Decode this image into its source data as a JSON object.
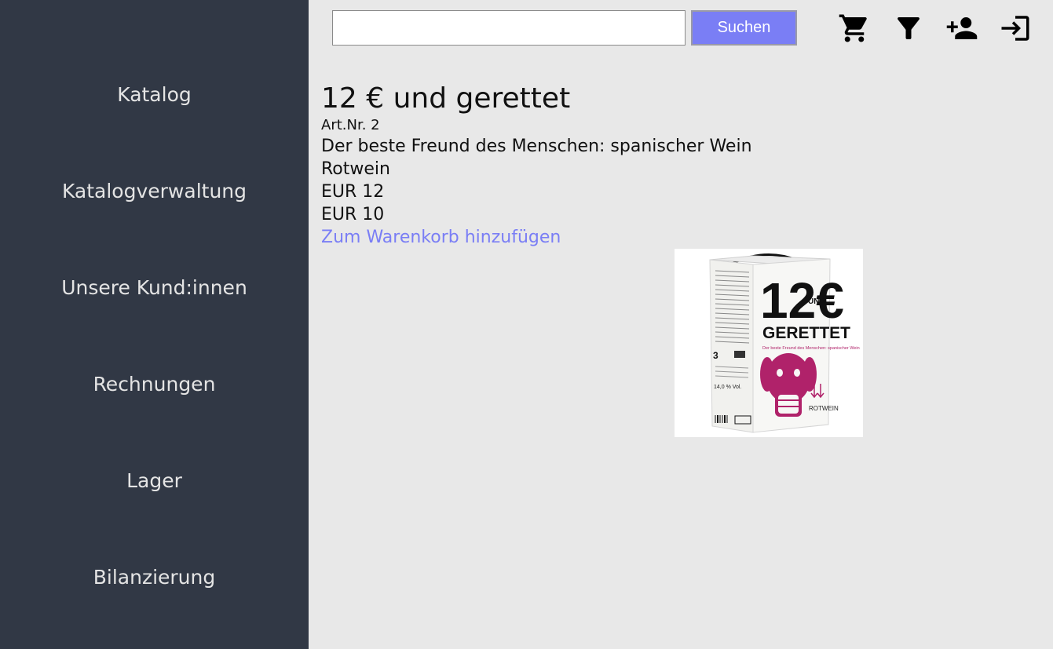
{
  "sidebar": {
    "items": [
      {
        "label": "Katalog"
      },
      {
        "label": "Katalogverwaltung"
      },
      {
        "label": "Unsere Kund:innen"
      },
      {
        "label": "Rechnungen"
      },
      {
        "label": "Lager"
      },
      {
        "label": "Bilanzierung"
      }
    ]
  },
  "header": {
    "search": {
      "value": "",
      "placeholder": ""
    },
    "search_button_label": "Suchen",
    "icons": [
      "shopping-cart-icon",
      "filter-icon",
      "add-user-icon",
      "login-icon"
    ]
  },
  "product": {
    "title": "12 € und gerettet",
    "article_number": "Art.Nr. 2",
    "description": "Der beste Freund des Menschen: spanischer Wein",
    "category": "Rotwein",
    "price_1": "EUR 12",
    "price_2": "EUR 10",
    "add_to_cart_label": "Zum Warenkorb hinzufügen",
    "image": {
      "big_number": "12€",
      "und": "UND",
      "gerettet": "GERETTET",
      "tagline": "Der beste Freund des Menschen: spanischer Wein",
      "volume": "14,0 % Vol.",
      "type": "ROTWEIN"
    }
  },
  "colors": {
    "sidebar_bg": "#313845",
    "content_bg": "#e8e8e8",
    "accent": "#7a7ef5",
    "wine_magenta": "#b0226a"
  }
}
